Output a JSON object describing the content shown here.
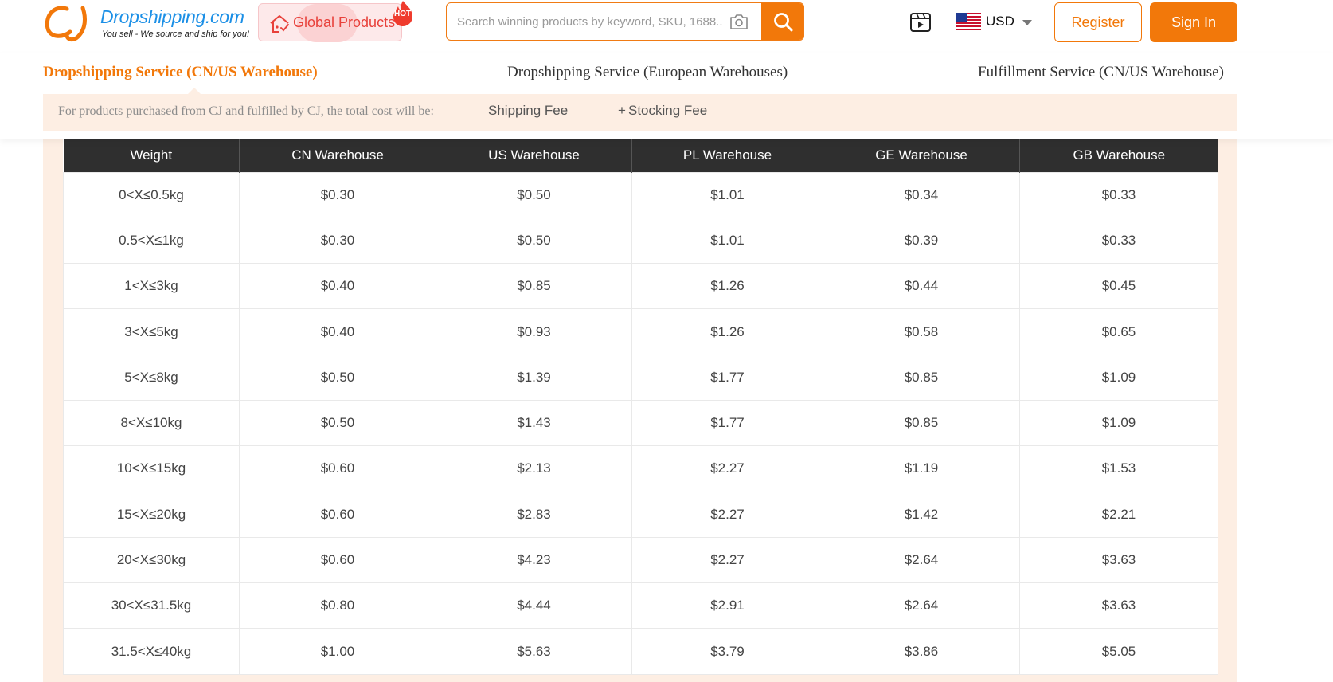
{
  "header": {
    "logo_name": "Dropshipping.com",
    "logo_tagline": "You sell - We source and ship for you!",
    "global_products_label": "Global Products",
    "hot_badge": "HOT",
    "search_placeholder": "Search winning products by keyword, SKU, 1688...",
    "currency": "USD",
    "register_label": "Register",
    "signin_label": "Sign In",
    "accent_color": "#f2780a"
  },
  "tabs": [
    {
      "label": "Dropshipping Service (CN/US Warehouse)",
      "active": true
    },
    {
      "label": "Dropshipping Service (European Warehouses)",
      "active": false
    },
    {
      "label": "Fulfillment Service (CN/US Warehouse)",
      "active": false
    }
  ],
  "notice": {
    "text": "For products purchased from CJ and fulfilled by CJ, the total cost will be:",
    "link1": "Shipping Fee",
    "plus": "+",
    "link2": "Stocking Fee"
  },
  "table": {
    "headers": [
      "Weight",
      "CN Warehouse",
      "US Warehouse",
      "PL Warehouse",
      "GE Warehouse",
      "GB Warehouse"
    ],
    "rows": [
      [
        "0<X≤0.5kg",
        "$0.30",
        "$0.50",
        "$1.01",
        "$0.34",
        "$0.33"
      ],
      [
        "0.5<X≤1kg",
        "$0.30",
        "$0.50",
        "$1.01",
        "$0.39",
        "$0.33"
      ],
      [
        "1<X≤3kg",
        "$0.40",
        "$0.85",
        "$1.26",
        "$0.44",
        "$0.45"
      ],
      [
        "3<X≤5kg",
        "$0.40",
        "$0.93",
        "$1.26",
        "$0.58",
        "$0.65"
      ],
      [
        "5<X≤8kg",
        "$0.50",
        "$1.39",
        "$1.77",
        "$0.85",
        "$1.09"
      ],
      [
        "8<X≤10kg",
        "$0.50",
        "$1.43",
        "$1.77",
        "$0.85",
        "$1.09"
      ],
      [
        "10<X≤15kg",
        "$0.60",
        "$2.13",
        "$2.27",
        "$1.19",
        "$1.53"
      ],
      [
        "15<X≤20kg",
        "$0.60",
        "$2.83",
        "$2.27",
        "$1.42",
        "$2.21"
      ],
      [
        "20<X≤30kg",
        "$0.60",
        "$4.23",
        "$2.27",
        "$2.64",
        "$3.63"
      ],
      [
        "30<X≤31.5kg",
        "$0.80",
        "$4.44",
        "$2.91",
        "$2.64",
        "$3.63"
      ],
      [
        "31.5<X≤40kg",
        "$1.00",
        "$5.63",
        "$3.79",
        "$3.86",
        "$5.05"
      ]
    ]
  }
}
